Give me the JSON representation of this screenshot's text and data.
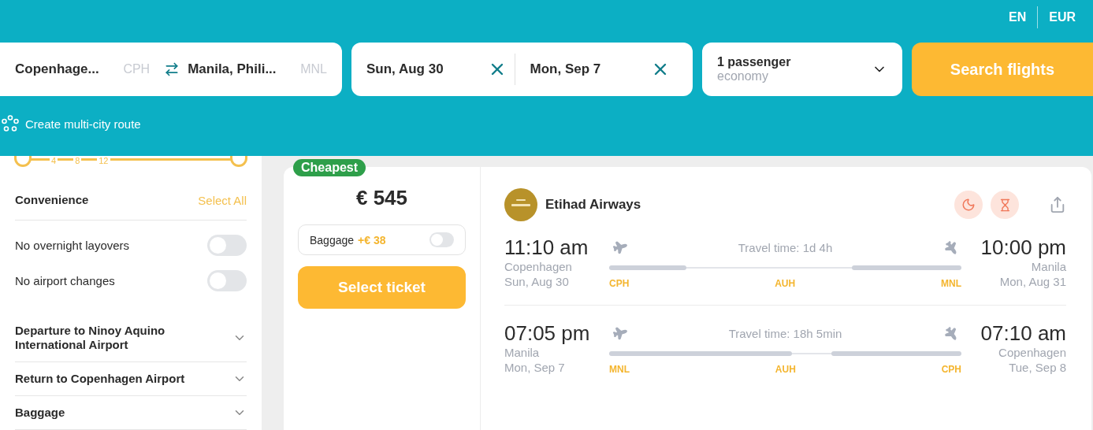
{
  "top_bar": {
    "language": "EN",
    "currency": "EUR"
  },
  "search": {
    "origin": {
      "city": "Copenhage...",
      "code": "CPH"
    },
    "destination": {
      "city": "Manila, Phili...",
      "code": "MNL"
    },
    "dates": [
      {
        "value": "Sun, Aug 30"
      },
      {
        "value": "Mon, Sep 7"
      }
    ],
    "passengers": {
      "count": "1 passenger",
      "cabin": "economy"
    },
    "button": "Search flights",
    "multi_city": "Create multi-city route"
  },
  "sidebar": {
    "slider": {
      "ticks": [
        "4",
        "8",
        "12"
      ],
      "low": {
        "level": 0
      },
      "high": {
        "level": 1
      }
    },
    "convenience": {
      "title": "Convenience",
      "select_all": "Select All",
      "options": [
        {
          "label": "No overnight layovers",
          "on": false
        },
        {
          "label": "No airport changes",
          "on": false
        }
      ]
    },
    "sections": [
      {
        "title": "Departure to Ninoy Aquino International Airport",
        "expanded": false
      },
      {
        "title": "Return to Copenhagen Airport",
        "expanded": false
      },
      {
        "title": "Baggage",
        "expanded": false
      }
    ]
  },
  "result": {
    "badge": "Cheapest",
    "price": "€ 545",
    "baggage": {
      "label": "Baggage",
      "extra": "+€ 38",
      "on": false
    },
    "button": "Select ticket",
    "airline": "Etihad Airways",
    "legs": [
      {
        "depart_time": "11:10 am",
        "depart_city": "Copenhagen",
        "depart_date": "Sun, Aug 30",
        "travel_time": "Travel time: 1d 4h",
        "arrive_time": "10:00 pm",
        "arrive_city": "Manila",
        "arrive_date": "Mon, Aug 31",
        "stops": [
          "CPH",
          "AUH",
          "MNL"
        ]
      },
      {
        "depart_time": "07:05 pm",
        "depart_city": "Manila",
        "depart_date": "Mon, Sep 7",
        "travel_time": "Travel time: 18h 5min",
        "arrive_time": "07:10 am",
        "arrive_city": "Copenhagen",
        "arrive_date": "Tue, Sep 8",
        "stops": [
          "MNL",
          "AUH",
          "CPH"
        ]
      }
    ]
  }
}
